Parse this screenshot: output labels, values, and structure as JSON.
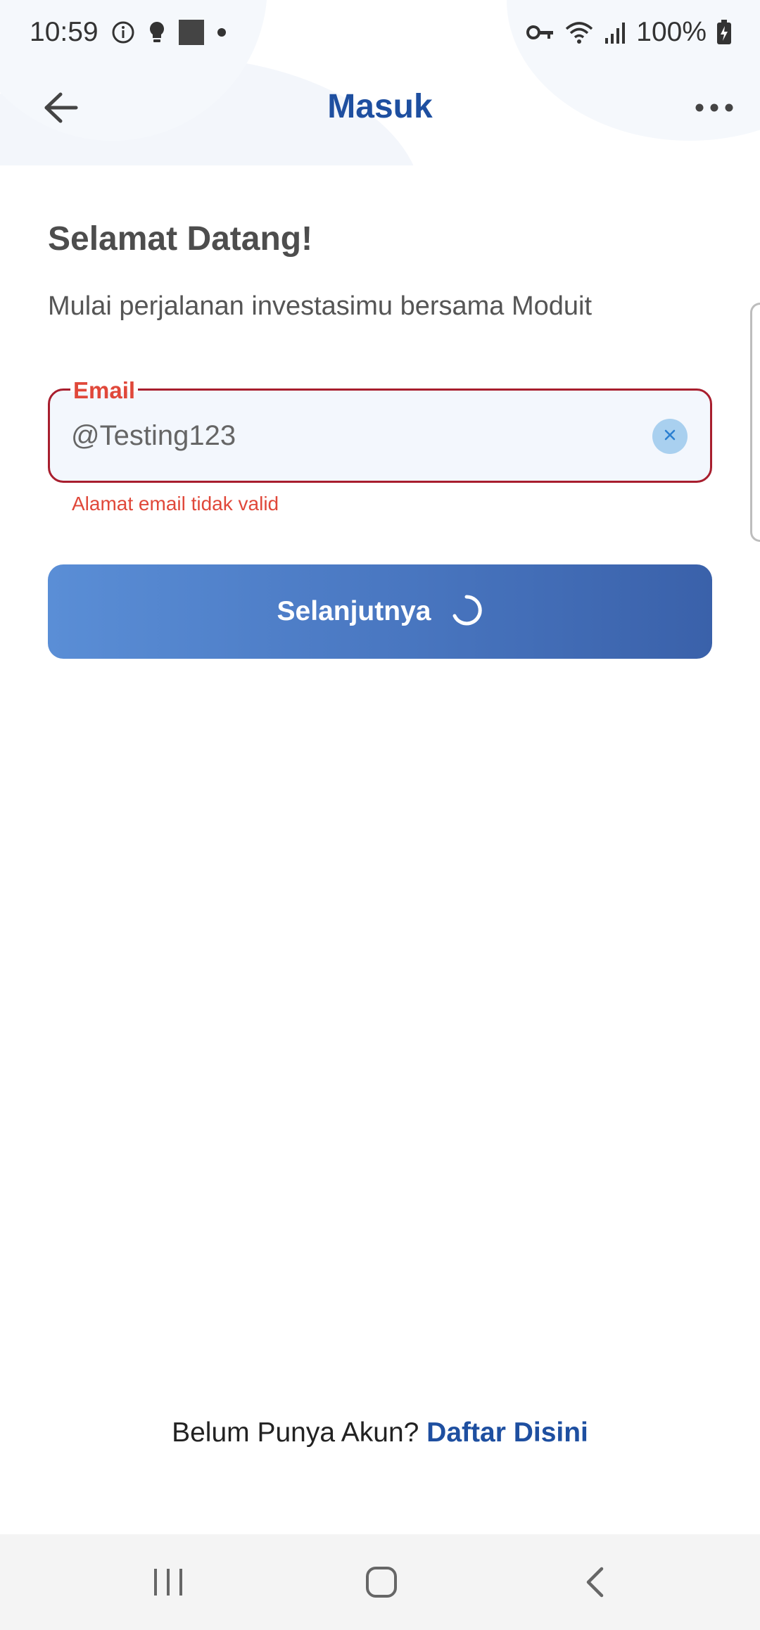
{
  "status_bar": {
    "time": "10:59",
    "battery": "100%",
    "left_icons": [
      "info-icon",
      "lightbulb-icon",
      "square-icon",
      "dot-icon"
    ],
    "right_icons": [
      "key-icon",
      "wifi-icon",
      "signal-icon",
      "battery-charging-icon"
    ]
  },
  "app_bar": {
    "title": "Masuk",
    "back_icon": "arrow-left-icon",
    "more_icon": "more-horizontal-icon"
  },
  "content": {
    "heading": "Selamat Datang!",
    "subtitle": "Mulai perjalanan investasimu bersama Moduit",
    "email_field": {
      "label": "Email",
      "value": "@Testing123",
      "error": "Alamat email tidak valid"
    },
    "next_button": {
      "label": "Selanjutnya",
      "loading": true
    },
    "signup_prompt": "Belum Punya Akun?",
    "signup_link": "Daftar Disini"
  },
  "colors": {
    "brand": "#1e4fa0",
    "error": "#e0483a",
    "field_border_error": "#a81e2e",
    "button_gradient_start": "#5a8ed6",
    "button_gradient_end": "#3a61aa"
  },
  "nav_bar": {
    "icons": [
      "recent-apps-icon",
      "home-icon",
      "back-icon"
    ]
  }
}
